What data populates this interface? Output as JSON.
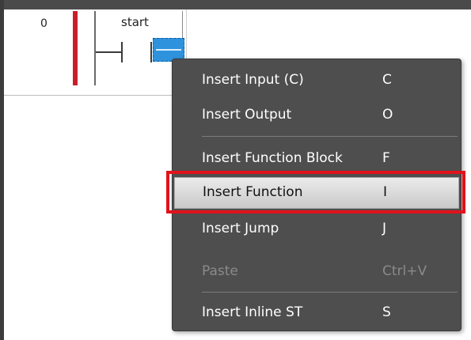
{
  "ladder": {
    "rung_number": "0",
    "contact_label": "start"
  },
  "context_menu": {
    "items": [
      {
        "label": "Insert Input (C)",
        "shortcut": "C",
        "enabled": true
      },
      {
        "label": "Insert Output",
        "shortcut": "O",
        "enabled": true
      },
      {
        "label": "Insert Function Block",
        "shortcut": "F",
        "enabled": true
      },
      {
        "label": "Insert Function",
        "shortcut": "I",
        "enabled": true,
        "highlighted": true
      },
      {
        "label": "Insert Jump",
        "shortcut": "J",
        "enabled": true
      },
      {
        "label": "Paste",
        "shortcut": "Ctrl+V",
        "enabled": false
      },
      {
        "label": "Insert Inline ST",
        "shortcut": "S",
        "enabled": true
      }
    ]
  },
  "colors": {
    "power_rail": "#c8202a",
    "selection": "#2f92dc",
    "menu_background": "#4e4e4e",
    "highlight_box": "#e0121c"
  }
}
